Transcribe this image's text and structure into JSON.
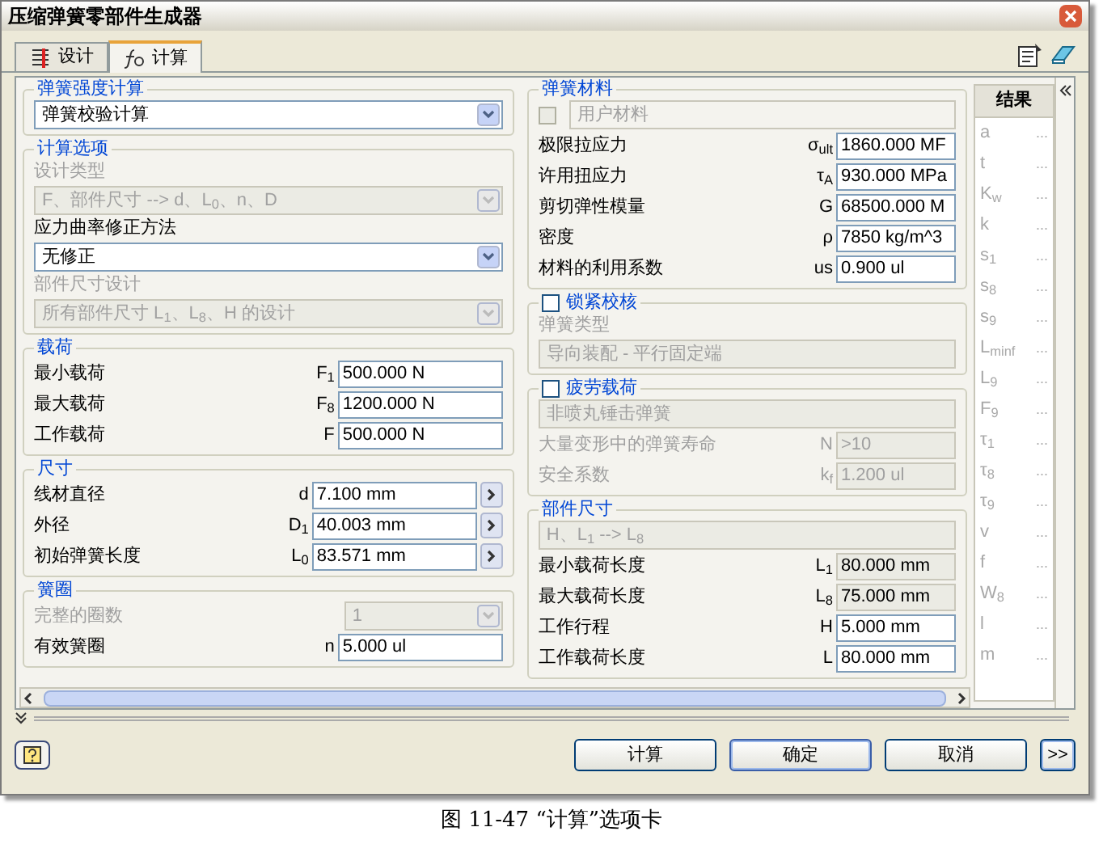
{
  "window": {
    "title": "压缩弹簧零部件生成器"
  },
  "tabs": [
    {
      "label": "设计",
      "kind": "design",
      "selected": false
    },
    {
      "label": "计算",
      "kind": "calc",
      "selected": true
    }
  ],
  "left_sections": [
    {
      "title": "弹簧强度计算",
      "rows": [
        {
          "kind": "dropdown",
          "value": "弹簧校验计算",
          "disabled": false
        }
      ]
    },
    {
      "title": "计算选项",
      "rows": [
        {
          "kind": "caption",
          "text": "设计类型",
          "disabled": true
        },
        {
          "kind": "dropdown",
          "value": "F、部件尺寸 --> d、L$_{0}$、n、D",
          "disabled": true
        },
        {
          "kind": "caption",
          "text": "应力曲率修正方法",
          "disabled": false
        },
        {
          "kind": "dropdown",
          "value": "无修正",
          "disabled": false
        },
        {
          "kind": "caption",
          "text": "部件尺寸设计",
          "disabled": true
        },
        {
          "kind": "dropdown",
          "value": "所有部件尺寸 L$_{1}$、L$_{8}$、H 的设计",
          "disabled": true
        }
      ]
    },
    {
      "title": "载荷",
      "rows": [
        {
          "kind": "field",
          "label": "最小载荷",
          "symbol": "F$_{1}$",
          "value": "500.000 N",
          "arrow": false,
          "disabled": false
        },
        {
          "kind": "field",
          "label": "最大载荷",
          "symbol": "F$_{8}$",
          "value": "1200.000 N",
          "arrow": false,
          "disabled": false
        },
        {
          "kind": "field",
          "label": "工作载荷",
          "symbol": "F",
          "value": "500.000 N",
          "arrow": false,
          "disabled": false
        }
      ]
    },
    {
      "title": "尺寸",
      "rows": [
        {
          "kind": "field",
          "label": "线材直径",
          "symbol": "d",
          "value": "7.100 mm",
          "arrow": true,
          "disabled": false
        },
        {
          "kind": "field",
          "label": "外径",
          "symbol": "D$_{1}$",
          "value": "40.003 mm",
          "arrow": true,
          "disabled": false
        },
        {
          "kind": "field",
          "label": "初始弹簧长度",
          "symbol": "L$_{0}$",
          "value": "83.571 mm",
          "arrow": true,
          "disabled": false
        }
      ]
    },
    {
      "title": "簧圈",
      "rows": [
        {
          "kind": "small_dropdown",
          "label": "完整的圈数",
          "value": "1",
          "disabled": true
        },
        {
          "kind": "field",
          "label": "有效簧圈",
          "symbol": "n",
          "value": "5.000 ul",
          "arrow": false,
          "disabled": false
        }
      ]
    }
  ],
  "right_sections": [
    {
      "title": "弹簧材料",
      "rows": [
        {
          "kind": "checkbox_field",
          "label": "用户材料",
          "checked": false,
          "disabled": true
        },
        {
          "kind": "field",
          "label": "极限拉应力",
          "symbol": "σ$_{ult}$",
          "value": "1860.000 MF",
          "arrow": false,
          "disabled": false
        },
        {
          "kind": "field",
          "label": "许用扭应力",
          "symbol": "τ$_{A}$",
          "value": "930.000 MPa",
          "arrow": false,
          "disabled": false
        },
        {
          "kind": "field",
          "label": "剪切弹性模量",
          "symbol": "G",
          "value": "68500.000 M",
          "arrow": false,
          "disabled": false
        },
        {
          "kind": "field",
          "label": "密度",
          "symbol": "ρ",
          "value": "7850 kg/m^3",
          "arrow": false,
          "disabled": false
        },
        {
          "kind": "field",
          "label": "材料的利用系数",
          "symbol": "us",
          "value": "0.900 ul",
          "arrow": false,
          "disabled": false
        }
      ]
    },
    {
      "title": "锁紧校核",
      "checked": false,
      "rows": [
        {
          "kind": "caption",
          "text": "弹簧类型",
          "disabled": true
        },
        {
          "kind": "dropdown",
          "value": "导向装配 - 平行固定端",
          "disabled": true
        }
      ]
    },
    {
      "title": "疲劳载荷",
      "checked": false,
      "rows": [
        {
          "kind": "dropdown",
          "value": "非喷丸锤击弹簧",
          "disabled": true
        },
        {
          "kind": "field",
          "label": "大量变形中的弹簧寿命",
          "symbol": "N",
          "value": ">10",
          "arrow": false,
          "disabled": true
        },
        {
          "kind": "field",
          "label": "安全系数",
          "symbol": "k$_{f}$",
          "value": "1.200 ul",
          "arrow": false,
          "disabled": true
        }
      ]
    },
    {
      "title": "部件尺寸",
      "rows": [
        {
          "kind": "dropdown",
          "value": "H、L$_{1}$ --> L$_{8}$",
          "disabled": true
        },
        {
          "kind": "field",
          "label": "最小载荷长度",
          "symbol": "L$_{1}$",
          "value": "80.000 mm",
          "arrow": false,
          "disabled": false,
          "readonly": true
        },
        {
          "kind": "field",
          "label": "最大载荷长度",
          "symbol": "L$_{8}$",
          "value": "75.000 mm",
          "arrow": false,
          "disabled": false,
          "readonly": true
        },
        {
          "kind": "field",
          "label": "工作行程",
          "symbol": "H",
          "value": "5.000 mm",
          "arrow": false,
          "disabled": false,
          "readonly": false
        },
        {
          "kind": "field",
          "label": "工作载荷长度",
          "symbol": "L",
          "value": "80.000 mm",
          "arrow": false,
          "disabled": false,
          "readonly": false
        }
      ]
    }
  ],
  "results": {
    "title": "结果",
    "items": [
      {
        "symbol": "a",
        "value": "..."
      },
      {
        "symbol": "t",
        "value": "..."
      },
      {
        "symbol": "K$_{w}$",
        "value": "..."
      },
      {
        "symbol": "k",
        "value": "..."
      },
      {
        "symbol": "s$_{1}$",
        "value": "..."
      },
      {
        "symbol": "s$_{8}$",
        "value": "..."
      },
      {
        "symbol": "s$_{9}$",
        "value": "..."
      },
      {
        "symbol": "L$_{minf}$",
        "value": "..."
      },
      {
        "symbol": "L$_{9}$",
        "value": "..."
      },
      {
        "symbol": "F$_{9}$",
        "value": "..."
      },
      {
        "symbol": "τ$_{1}$",
        "value": "..."
      },
      {
        "symbol": "τ$_{8}$",
        "value": "..."
      },
      {
        "symbol": "τ$_{9}$",
        "value": "..."
      },
      {
        "symbol": "v",
        "value": "..."
      },
      {
        "symbol": "f",
        "value": "..."
      },
      {
        "symbol": "W$_{8}$",
        "value": "..."
      },
      {
        "symbol": "l",
        "value": "..."
      },
      {
        "symbol": "m",
        "value": "..."
      }
    ]
  },
  "buttons": [
    {
      "label": "计算",
      "default": false
    },
    {
      "label": "确定",
      "default": true
    },
    {
      "label": "取消",
      "default": false
    }
  ],
  "expand_button": ">>",
  "caption": "图 11-47 “计算”选项卡"
}
